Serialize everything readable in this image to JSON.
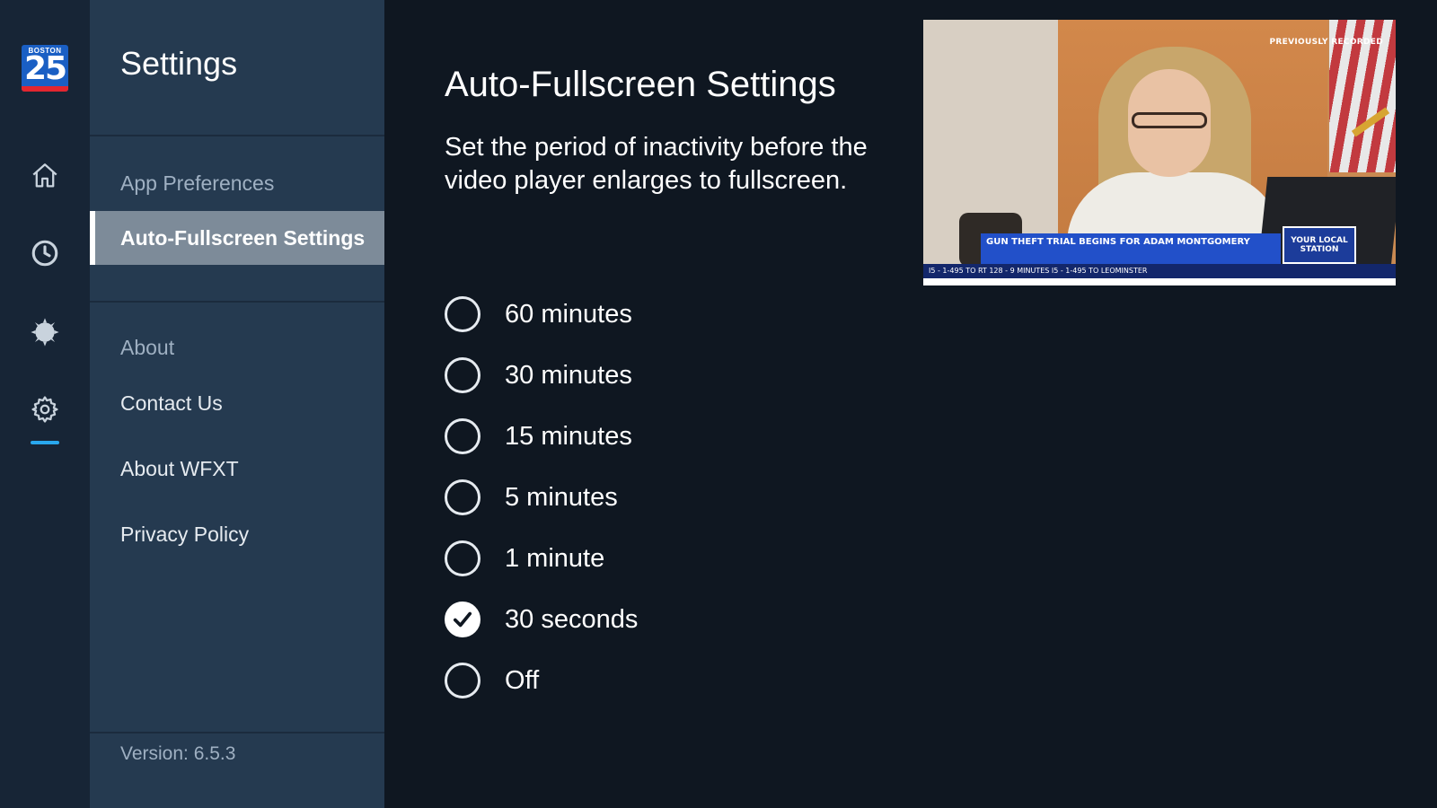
{
  "brand": {
    "logo_top": "BOSTON",
    "logo_number": "25"
  },
  "rail": {
    "icons": [
      "home-icon",
      "clock-icon",
      "weather-icon",
      "gear-icon"
    ],
    "active_icon": "gear-icon",
    "accent_color": "#29a8ee"
  },
  "menu": {
    "title": "Settings",
    "items": [
      {
        "label": "App Preferences",
        "style": "dim"
      },
      {
        "label": "Auto-Fullscreen Settings",
        "style": "selected"
      },
      {
        "label": "About",
        "style": "dim"
      },
      {
        "label": "Contact Us",
        "style": "normal"
      },
      {
        "label": "About WFXT",
        "style": "normal"
      },
      {
        "label": "Privacy Policy",
        "style": "normal"
      }
    ],
    "version": "Version: 6.5.3"
  },
  "content": {
    "title": "Auto-Fullscreen Settings",
    "description": "Set the period of inactivity before the video player enlarges to fullscreen.",
    "options": [
      {
        "label": "60 minutes",
        "checked": false
      },
      {
        "label": "30 minutes",
        "checked": false
      },
      {
        "label": "15 minutes",
        "checked": false
      },
      {
        "label": "5 minutes",
        "checked": false
      },
      {
        "label": "1 minute",
        "checked": false
      },
      {
        "label": "30 seconds",
        "checked": true
      },
      {
        "label": "Off",
        "checked": false
      }
    ]
  },
  "video": {
    "tag": "PREVIOUSLY RECORDED",
    "headline": "GUN THEFT TRIAL BEGINS FOR ADAM MONTGOMERY",
    "station_bug": "YOUR LOCAL STATION",
    "ticker": "I5 - 1-495 TO RT 128 - 9 MINUTES     I5 - 1-495 TO LEOMINSTER"
  },
  "colors": {
    "background": "#0f1721",
    "rail": "#172536",
    "menu": "#253a50",
    "selected": "#7d8b99"
  }
}
